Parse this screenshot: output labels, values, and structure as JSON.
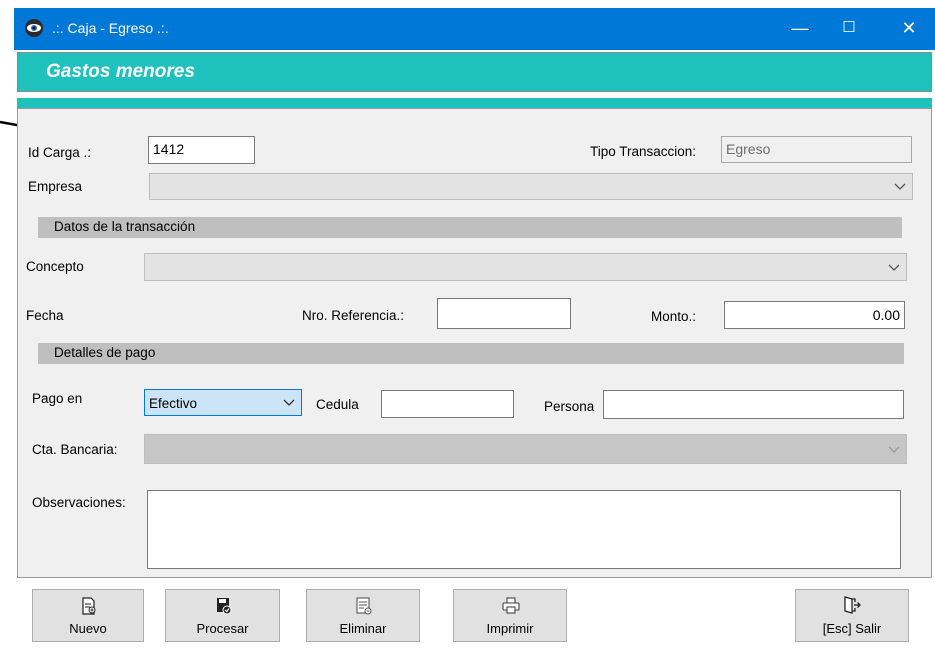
{
  "window": {
    "title": ".:. Caja - Egreso .:.",
    "icon": "eye-icon",
    "minimize": "—",
    "maximize": "☐",
    "close": "✕"
  },
  "header": {
    "title": "Gastos menores"
  },
  "form": {
    "id_carga_label": "Id Carga .:",
    "id_carga_value": "1412",
    "tipo_label": "Tipo Transaccion:",
    "tipo_value": "Egreso",
    "empresa_label": "Empresa",
    "empresa_value": "",
    "section_transaction": "Datos de la transacción",
    "concepto_label": "Concepto",
    "concepto_value": "",
    "fecha_label": "Fecha",
    "referencia_label": "Nro. Referencia.:",
    "referencia_value": "",
    "monto_label": "Monto.:",
    "monto_value": "0.00",
    "section_payment": "Detalles de pago",
    "pago_label": "Pago en",
    "pago_value": "Efectivo",
    "cedula_label": "Cedula",
    "cedula_value": "",
    "persona_label": "Persona",
    "persona_value": "",
    "cta_label": "Cta. Bancaria:",
    "cta_value": "",
    "obs_label": "Observaciones:",
    "obs_value": ""
  },
  "buttons": {
    "nuevo": "Nuevo",
    "procesar": "Procesar",
    "eliminar": "Eliminar",
    "imprimir": "Imprimir",
    "salir": "[Esc] Salir"
  },
  "colors": {
    "titlebar": "#0078d7",
    "header": "#1ec1bb",
    "panel": "#f0f0f0",
    "section": "#bfbfbf",
    "selected_combo": "#cce4f7"
  }
}
